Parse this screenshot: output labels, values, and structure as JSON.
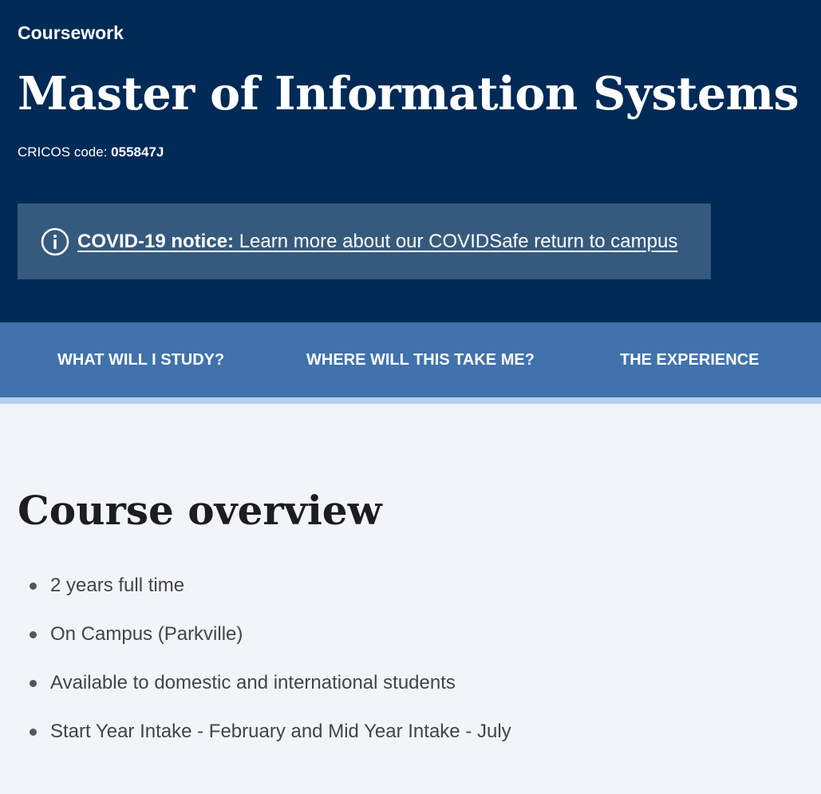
{
  "hero": {
    "eyebrow": "Coursework",
    "title": "Master of Information Systems",
    "cricos_label": "CRICOS code:",
    "cricos_code": "055847J",
    "background_color": "#012a57"
  },
  "notice": {
    "icon": "info-circle-icon",
    "label": "COVID-19 notice:",
    "text": "Learn more about our COVIDSafe return to campus",
    "background_color": "#365a7d"
  },
  "nav": {
    "background_color": "#4172ac",
    "accent_color": "#b5d0ee",
    "items": [
      {
        "label": "WHAT WILL I STUDY?"
      },
      {
        "label": "WHERE WILL THIS TAKE ME?"
      },
      {
        "label": "THE EXPERIENCE"
      }
    ]
  },
  "overview": {
    "title": "Course overview",
    "facts": [
      "2 years full time",
      "On Campus (Parkville)",
      "Available to domestic and international students",
      "Start Year Intake - February and Mid Year Intake - July"
    ]
  }
}
